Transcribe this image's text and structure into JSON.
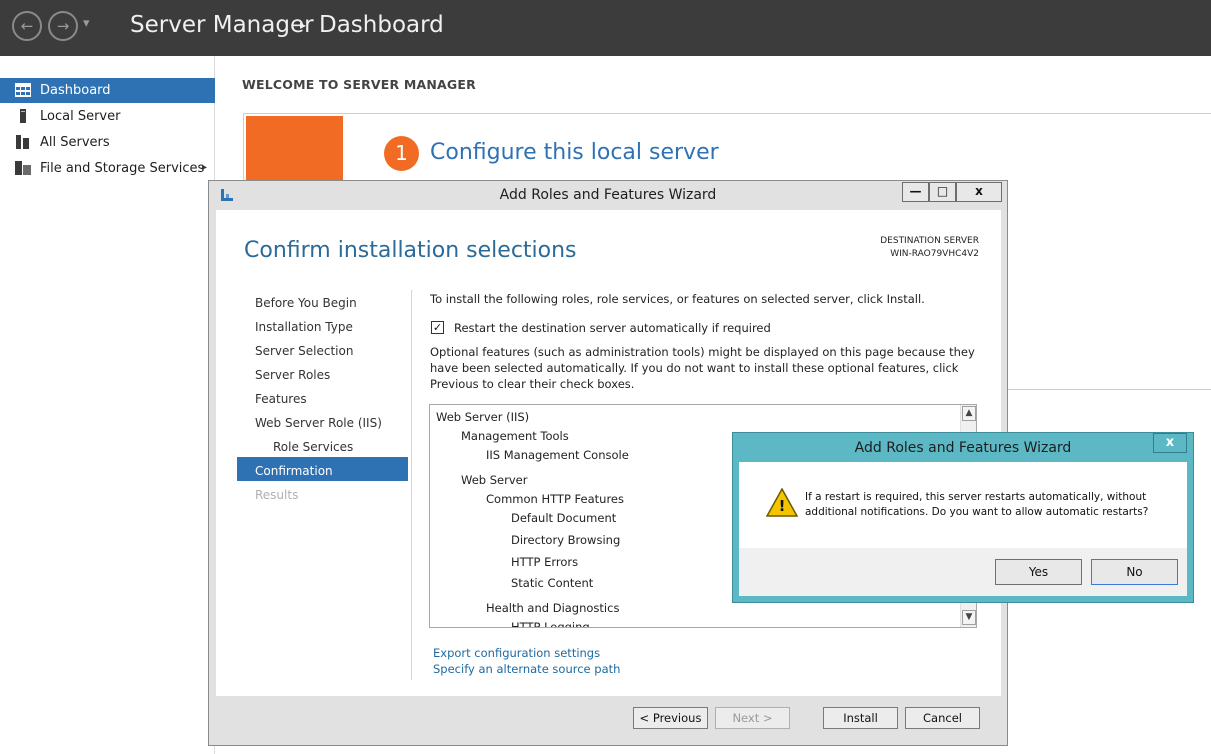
{
  "topbar": {
    "back": "←",
    "forward": "→",
    "dropdown": "▾",
    "app_title": "Server Manager",
    "separator": "▸",
    "page_title": "Dashboard"
  },
  "sidebar": {
    "items": [
      {
        "label": "Dashboard",
        "icon": "dashboard-icon"
      },
      {
        "label": "Local Server",
        "icon": "server-icon"
      },
      {
        "label": "All Servers",
        "icon": "servers-icon"
      },
      {
        "label": "File and Storage Services",
        "icon": "storage-icon",
        "arrow": "▸"
      }
    ]
  },
  "welcome": {
    "heading": "WELCOME TO SERVER MANAGER",
    "step_number": "1",
    "step_text": "Configure this local server"
  },
  "wizard": {
    "title": "Add Roles and Features Wizard",
    "minimize": "—",
    "maximize": "□",
    "close": "x",
    "heading": "Confirm installation selections",
    "destination_label": "DESTINATION SERVER",
    "destination_name": "WIN-RAO79VHC4V2",
    "steps": [
      {
        "label": "Before You Begin"
      },
      {
        "label": "Installation Type"
      },
      {
        "label": "Server Selection"
      },
      {
        "label": "Server Roles"
      },
      {
        "label": "Features"
      },
      {
        "label": "Web Server Role (IIS)"
      },
      {
        "label": "Role Services"
      },
      {
        "label": "Confirmation"
      },
      {
        "label": "Results"
      }
    ],
    "intro": "To install the following roles, role services, or features on selected server, click Install.",
    "checkbox_label": "Restart the destination server automatically if required",
    "checkbox_mark": "✓",
    "optional_note": "Optional features (such as administration tools) might be displayed on this page because they have been selected automatically. If you do not want to install these optional features, click Previous to clear their check boxes.",
    "tree": [
      "Web Server (IIS)",
      "Management Tools",
      "IIS Management Console",
      "Web Server",
      "Common HTTP Features",
      "Default Document",
      "Directory Browsing",
      "HTTP Errors",
      "Static Content",
      "Health and Diagnostics",
      "HTTP Logging"
    ],
    "scroll_up": "▲",
    "scroll_down": "▼",
    "link_export": "Export configuration settings",
    "link_source": "Specify an alternate source path",
    "btn_previous": "< Previous",
    "btn_next": "Next >",
    "btn_install": "Install",
    "btn_cancel": "Cancel"
  },
  "dialog": {
    "title": "Add Roles and Features Wizard",
    "close": "x",
    "warning_glyph": "!",
    "message": "If a restart is required, this server restarts automatically, without additional notifications. Do you want to allow automatic restarts?",
    "btn_yes": "Yes",
    "btn_no": "No"
  }
}
